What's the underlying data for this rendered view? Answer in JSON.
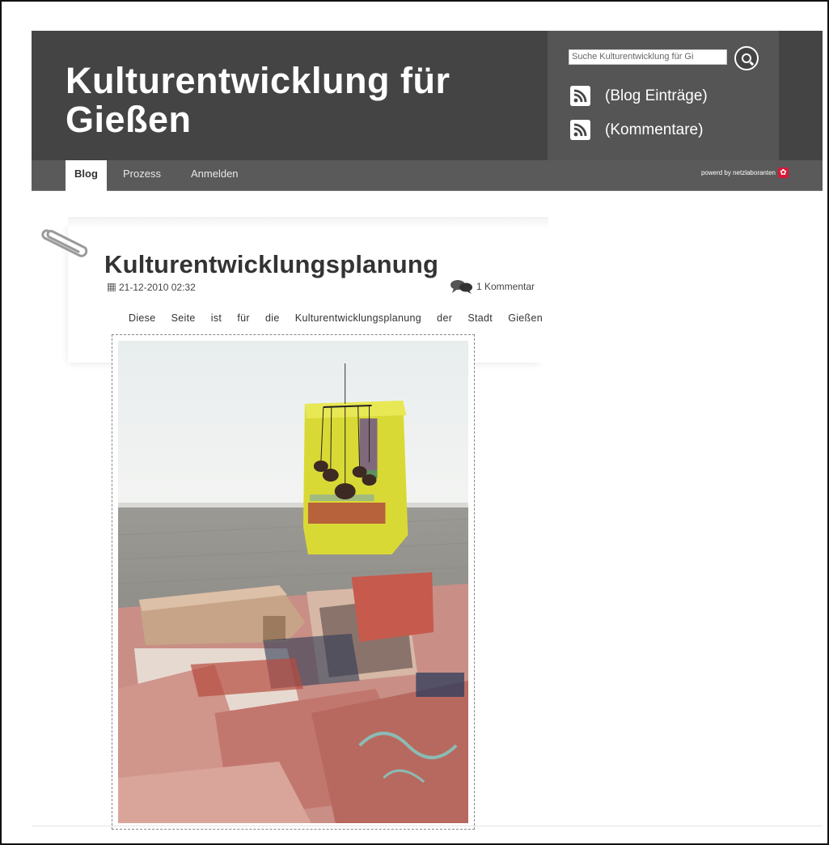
{
  "site": {
    "title": "Kulturentwicklung für Gießen"
  },
  "search": {
    "value": "Suche Kulturentwicklung für Gi"
  },
  "feeds": [
    {
      "label": "(Blog Einträge)",
      "icon": "rss-icon"
    },
    {
      "label": "(Kommentare)",
      "icon": "rss-icon"
    }
  ],
  "nav": {
    "items": [
      {
        "label": "Blog",
        "active": true
      },
      {
        "label": "Prozess",
        "active": false
      },
      {
        "label": "Anmelden",
        "active": false
      }
    ],
    "powered_by": "powerd by netzlaboranten"
  },
  "post": {
    "title": "Kulturentwicklungsplanung",
    "date": "21-12-2010 02:32",
    "comments": "1 Kommentar",
    "body": "Diese Seite ist für die Kulturentwicklungsplanung der Stadt Gießen"
  },
  "colors": {
    "header_bg": "#444444",
    "panel_bg": "#555555",
    "nav_bg": "#5a5a5a",
    "brand_red": "#d21b3a"
  }
}
